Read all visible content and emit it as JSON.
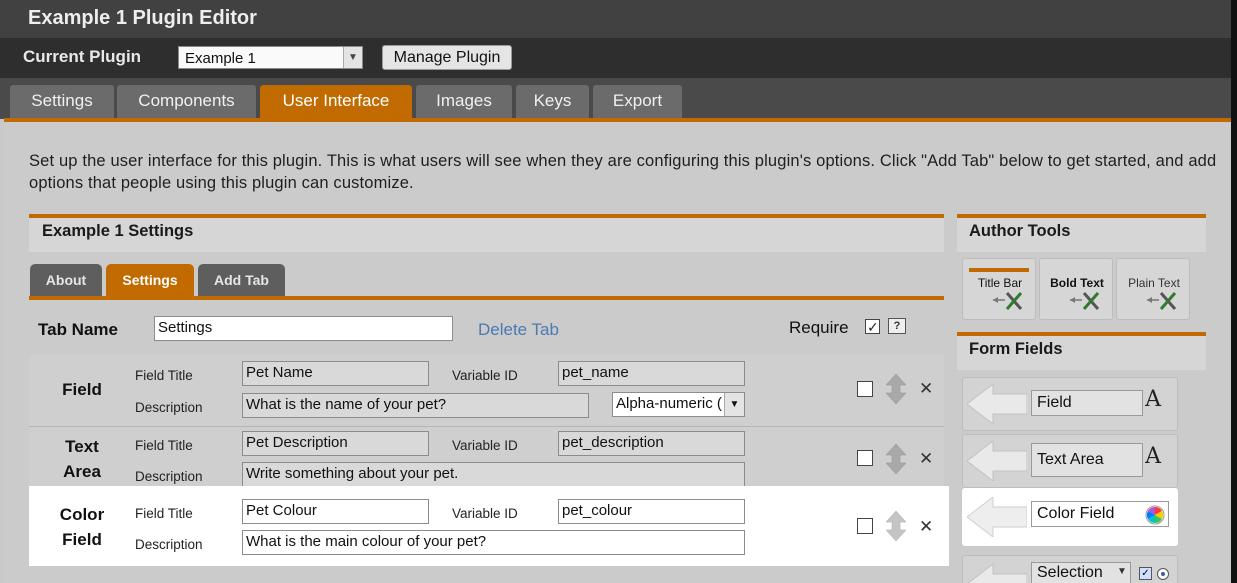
{
  "app": {
    "title": "Example 1 Plugin Editor"
  },
  "plugin_bar": {
    "label": "Current Plugin",
    "selected": "Example 1",
    "manage_button": "Manage Plugin"
  },
  "main_tabs": [
    {
      "label": "Settings"
    },
    {
      "label": "Components"
    },
    {
      "label": "User Interface",
      "active": true
    },
    {
      "label": "Images"
    },
    {
      "label": "Keys"
    },
    {
      "label": "Export"
    }
  ],
  "intro": "Set up the user interface for this plugin. This is what users will see when they are configuring this plugin's options. Click \"Add Tab\" below to get started, and add options that people using this plugin can customize.",
  "settings_panel": {
    "title": "Example 1 Settings",
    "tabs": [
      {
        "label": "About"
      },
      {
        "label": "Settings",
        "active": true
      },
      {
        "label": "Add Tab"
      }
    ],
    "tab_name_label": "Tab Name",
    "tab_name_value": "Settings",
    "delete_tab": "Delete Tab",
    "require_label": "Require",
    "require_checked": true,
    "help_icon_text": "?"
  },
  "labels": {
    "field_title": "Field Title",
    "description": "Description",
    "variable_id": "Variable ID"
  },
  "fields": [
    {
      "type_line1": "Field",
      "type_line2": "",
      "title": "Pet Name",
      "variable_id": "pet_name",
      "description": "What is the name of your pet?",
      "format": "Alpha-numeric ("
    },
    {
      "type_line1": "Text",
      "type_line2": "Area",
      "title": "Pet Description",
      "variable_id": "pet_description",
      "description": "Write something about your pet."
    },
    {
      "type_line1": "Color",
      "type_line2": "Field",
      "title": "Pet Colour",
      "variable_id": "pet_colour",
      "description": "What is the main colour of your pet?"
    }
  ],
  "author_tools": {
    "title": "Author Tools",
    "items": [
      {
        "label": "Title Bar"
      },
      {
        "label": "Bold Text"
      },
      {
        "label": "Plain Text"
      }
    ]
  },
  "form_fields": {
    "title": "Form Fields",
    "items": [
      {
        "label": "Field",
        "glyph": "A"
      },
      {
        "label": "Text Area",
        "glyph": "A"
      },
      {
        "label": "Color Field",
        "icon": "color-wheel-icon"
      },
      {
        "label": "Selection"
      }
    ]
  },
  "colors": {
    "accent": "#c06a00",
    "titlebar": "#414141",
    "link": "#4a7ab2"
  }
}
